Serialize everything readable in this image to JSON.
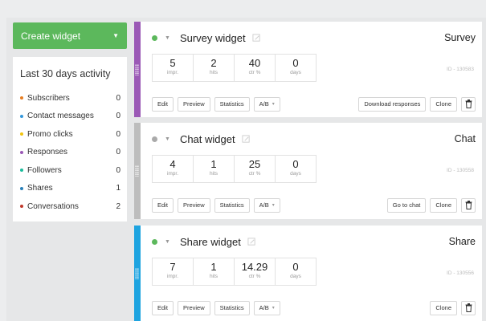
{
  "sidebar": {
    "create_label": "Create widget",
    "activity_title": "Last 30 days activity",
    "items": [
      {
        "label": "Subscribers",
        "count": "0",
        "color": "#e67e22"
      },
      {
        "label": "Contact messages",
        "count": "0",
        "color": "#3498db"
      },
      {
        "label": "Promo clicks",
        "count": "0",
        "color": "#f1c40f"
      },
      {
        "label": "Responses",
        "count": "0",
        "color": "#9b59b6"
      },
      {
        "label": "Followers",
        "count": "0",
        "color": "#1abc9c"
      },
      {
        "label": "Shares",
        "count": "1",
        "color": "#2980b9"
      },
      {
        "label": "Conversations",
        "count": "2",
        "color": "#c0392b"
      }
    ]
  },
  "widgets": [
    {
      "name": "Survey widget",
      "type": "Survey",
      "status_color": "#5cb85c",
      "accent": "#9b59b6",
      "stats": [
        {
          "value": "5",
          "label": "impr."
        },
        {
          "value": "2",
          "label": "hits"
        },
        {
          "value": "40",
          "label": "ctr %"
        },
        {
          "value": "0",
          "label": "days"
        }
      ],
      "id_text": "ID - 130583",
      "buttons": {
        "edit": "Edit",
        "preview": "Preview",
        "statistics": "Statistics",
        "ab": "A/B",
        "extra": "Download responses",
        "clone": "Clone"
      }
    },
    {
      "name": "Chat widget",
      "type": "Chat",
      "status_color": "#aaaaaa",
      "accent": "#bdbdbd",
      "stats": [
        {
          "value": "4",
          "label": "impr."
        },
        {
          "value": "1",
          "label": "hits"
        },
        {
          "value": "25",
          "label": "ctr %"
        },
        {
          "value": "0",
          "label": "days"
        }
      ],
      "id_text": "ID - 130558",
      "buttons": {
        "edit": "Edit",
        "preview": "Preview",
        "statistics": "Statistics",
        "ab": "A/B",
        "extra": "Go to chat",
        "clone": "Clone"
      }
    },
    {
      "name": "Share widget",
      "type": "Share",
      "status_color": "#5cb85c",
      "accent": "#1ea4e0",
      "stats": [
        {
          "value": "7",
          "label": "impr."
        },
        {
          "value": "1",
          "label": "hits"
        },
        {
          "value": "14.29",
          "label": "ctr %"
        },
        {
          "value": "0",
          "label": "days"
        }
      ],
      "id_text": "ID - 130556",
      "buttons": {
        "edit": "Edit",
        "preview": "Preview",
        "statistics": "Statistics",
        "ab": "A/B",
        "clone": "Clone"
      }
    }
  ]
}
